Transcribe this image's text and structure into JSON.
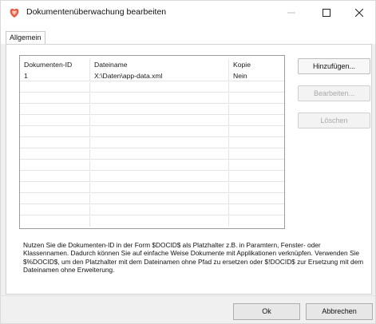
{
  "window": {
    "title": "Dokumentenüberwachung bearbeiten",
    "icon": "app-logo-icon",
    "controls": {
      "minimize": "—",
      "maximize": "☐",
      "close": "✕"
    }
  },
  "tabs": [
    {
      "label": "Allgemein",
      "active": true
    }
  ],
  "grid": {
    "columns": [
      "Dokumenten-ID",
      "Dateiname",
      "Kopie"
    ],
    "rows": [
      [
        "1",
        "X:\\Daten\\app-data.xml",
        "Nein"
      ]
    ],
    "empty_rows": 12
  },
  "side_buttons": {
    "add": "Hinzufügen...",
    "edit": "Bearbeiten...",
    "delete": "Löschen"
  },
  "info_text": "Nutzen Sie die Dokumenten-ID in der Form $DOCID$ als Platzhalter z.B. in Paramtern, Fenster- oder Klassennamen. Dadurch können Sie auf einfache Weise Dokumente mit Applikationen verknüpfen. Verwenden Sie $%DOCID$, um den Platzhalter mit dem Dateinamen ohne Pfad zu ersetzen oder $!DOCID$ zur Ersetzung mit dem Dateinamen ohne Erweiterung.",
  "footer": {
    "ok": "Ok",
    "cancel": "Abbrechen"
  },
  "colors": {
    "logo_outer": "#e25d4a",
    "logo_inner": "#f3a98a"
  }
}
